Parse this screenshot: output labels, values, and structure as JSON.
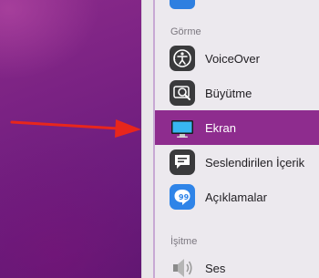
{
  "sidebar": {
    "sections": [
      {
        "label": "Görme",
        "items": [
          {
            "label": "VoiceOver",
            "icon": "voiceover-icon"
          },
          {
            "label": "Büyütme",
            "icon": "zoom-icon"
          },
          {
            "label": "Ekran",
            "icon": "display-icon",
            "selected": true
          },
          {
            "label": "Seslendirilen İçerik",
            "icon": "spoken-content-icon"
          },
          {
            "label": "Açıklamalar",
            "icon": "descriptions-icon"
          }
        ]
      },
      {
        "label": "İşitme",
        "items": [
          {
            "label": "Ses",
            "icon": "speaker-icon"
          }
        ]
      }
    ]
  },
  "colors": {
    "selection": "#8e2c8e",
    "arrow": "#e8261c",
    "wallpaper": "#7a2283"
  }
}
